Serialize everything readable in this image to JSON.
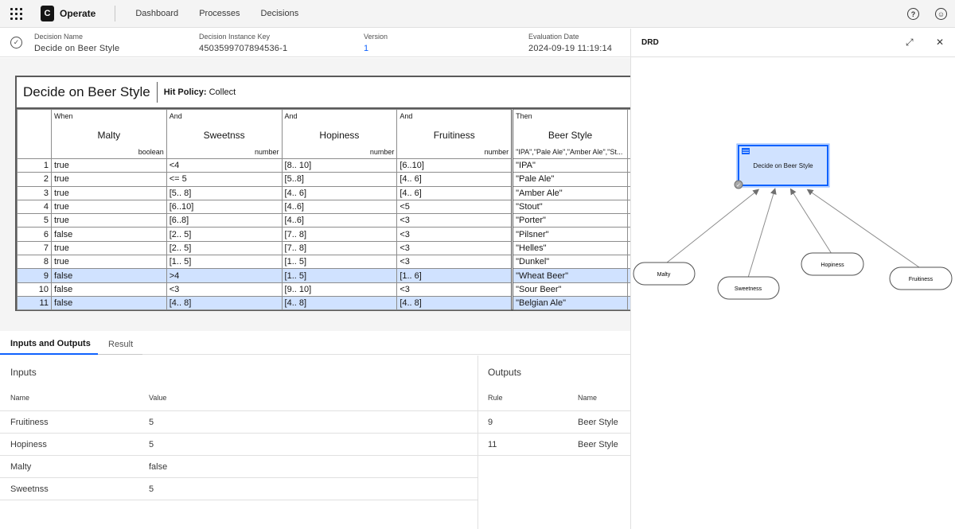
{
  "topbar": {
    "logo_letter": "C",
    "app_name": "Operate",
    "nav": [
      "Dashboard",
      "Processes",
      "Decisions"
    ],
    "help_glyph": "?",
    "user_glyph": "☺"
  },
  "instance": {
    "decision_name_label": "Decision Name",
    "decision_name": "Decide on Beer Style",
    "key_label": "Decision Instance Key",
    "key": "4503599707894536-1",
    "version_label": "Version",
    "version": "1",
    "date_label": "Evaluation Date",
    "date": "2024-09-19 11:19:14"
  },
  "table": {
    "title": "Decide on Beer Style",
    "hit_policy_label": "Hit Policy:",
    "hit_policy": "Collect",
    "columns": [
      {
        "keyword": "When",
        "name": "Malty",
        "type": "boolean"
      },
      {
        "keyword": "And",
        "name": "Sweetnss",
        "type": "number"
      },
      {
        "keyword": "And",
        "name": "Hopiness",
        "type": "number"
      },
      {
        "keyword": "And",
        "name": "Fruitiness",
        "type": "number"
      },
      {
        "keyword": "Then",
        "name": "Beer Style",
        "type": "\"IPA\",\"Pale Ale\",\"Amber Ale\",\"St..."
      }
    ],
    "rows": [
      {
        "n": "1",
        "c": [
          "true",
          "<4",
          "[8.. 10]",
          "[6..10]",
          "\"IPA\""
        ],
        "selected": false
      },
      {
        "n": "2",
        "c": [
          "true",
          "<= 5",
          "[5..8]",
          "[4.. 6]",
          "\"Pale Ale\""
        ],
        "selected": false
      },
      {
        "n": "3",
        "c": [
          "true",
          "[5.. 8]",
          "[4.. 6]",
          "[4.. 6]",
          "\"Amber Ale\""
        ],
        "selected": false
      },
      {
        "n": "4",
        "c": [
          "true",
          "[6..10]",
          "[4..6]",
          "<5",
          "\"Stout\""
        ],
        "selected": false
      },
      {
        "n": "5",
        "c": [
          "true",
          "[6..8]",
          "[4..6]",
          "<3",
          "\"Porter\""
        ],
        "selected": false
      },
      {
        "n": "6",
        "c": [
          "false",
          "[2.. 5]",
          "[7.. 8]",
          "<3",
          "\"Pilsner\""
        ],
        "selected": false
      },
      {
        "n": "7",
        "c": [
          "true",
          "[2.. 5]",
          "[7.. 8]",
          "<3",
          "\"Helles\""
        ],
        "selected": false
      },
      {
        "n": "8",
        "c": [
          "true",
          "[1.. 5]",
          "[1.. 5]",
          "<3",
          "\"Dunkel\""
        ],
        "selected": false
      },
      {
        "n": "9",
        "c": [
          "false",
          ">4",
          "[1.. 5]",
          "[1.. 6]",
          "\"Wheat Beer\""
        ],
        "selected": true
      },
      {
        "n": "10",
        "c": [
          "false",
          "<3",
          "[9.. 10]",
          "<3",
          "\"Sour Beer\""
        ],
        "selected": false
      },
      {
        "n": "11",
        "c": [
          "false",
          "[4.. 8]",
          "[4.. 8]",
          "[4.. 8]",
          "\"Belgian Ale\""
        ],
        "selected": true
      }
    ]
  },
  "tabs": {
    "inputs_outputs": "Inputs and Outputs",
    "result": "Result"
  },
  "inputs": {
    "title": "Inputs",
    "col_name": "Name",
    "col_value": "Value",
    "rows": [
      {
        "name": "Fruitiness",
        "value": "5"
      },
      {
        "name": "Hopiness",
        "value": "5"
      },
      {
        "name": "Malty",
        "value": "false"
      },
      {
        "name": "Sweetnss",
        "value": "5"
      }
    ]
  },
  "outputs": {
    "title": "Outputs",
    "col_rule": "Rule",
    "col_name": "Name",
    "rows": [
      {
        "rule": "9",
        "name": "Beer Style"
      },
      {
        "rule": "11",
        "name": "Beer Style"
      }
    ]
  },
  "drd": {
    "title": "DRD",
    "decision": "Decide on Beer Style",
    "inputs": [
      "Malty",
      "Sweetness",
      "Hopiness",
      "Fruitiness"
    ],
    "colors": {
      "decision_fill": "#d0e2ff",
      "decision_border": "#0f62fe"
    }
  }
}
